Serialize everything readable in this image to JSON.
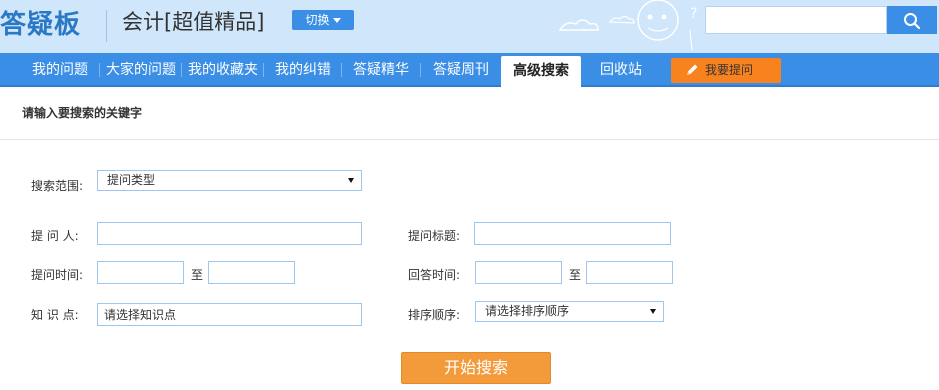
{
  "header": {
    "logo": "答疑板",
    "subject": "会计[超值精品]",
    "switch_label": "切换",
    "search_value": "",
    "search_icon": "search-icon"
  },
  "nav": {
    "items": [
      {
        "label": "我的问题"
      },
      {
        "label": "大家的问题"
      },
      {
        "label": "我的收藏夹"
      },
      {
        "label": "我的纠错"
      },
      {
        "label": "答疑精华"
      },
      {
        "label": "答疑周刊"
      },
      {
        "label": "高级搜索",
        "active": true
      },
      {
        "label": "回收站"
      }
    ],
    "ask_label": "我要提问"
  },
  "form": {
    "title": "请输入要搜索的关键字",
    "scope_label": "搜索范围:",
    "scope_value": "提问类型",
    "asker_label": "提 问 人:",
    "asker_value": "",
    "question_title_label": "提问标题:",
    "question_title_value": "",
    "ask_time_label": "提问时间:",
    "ask_time_from": "",
    "ask_time_to_label": "至",
    "ask_time_to": "",
    "answer_time_label": "回答时间:",
    "answer_time_from": "",
    "answer_time_to_label": "至",
    "answer_time_to": "",
    "knowledge_label": "知 识 点:",
    "knowledge_value": "请选择知识点",
    "sort_label": "排序顺序:",
    "sort_value": "请选择排序顺序",
    "submit_label": "开始搜索"
  },
  "colors": {
    "header_bg": "#cfe6fb",
    "nav_bg": "#3a8ee6",
    "accent_orange": "#f7821e",
    "submit_orange": "#f39b3b",
    "logo_blue": "#2b78c5"
  }
}
